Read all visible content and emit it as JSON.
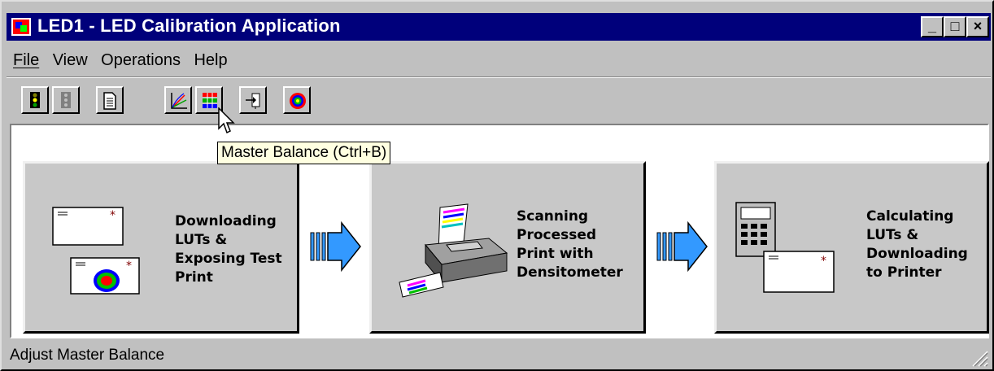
{
  "window": {
    "title": "LED1 - LED Calibration Application"
  },
  "titlebar_buttons": {
    "minimize": "_",
    "maximize": "□",
    "close": "×"
  },
  "menu": [
    "File",
    "View",
    "Operations",
    "Help"
  ],
  "toolbar": {
    "buttons": [
      {
        "name": "traffic-light-active-icon"
      },
      {
        "name": "traffic-light-inactive-icon"
      },
      {
        "name": "document-icon"
      },
      {
        "name": "curve-graph-icon"
      },
      {
        "name": "master-balance-icon"
      },
      {
        "name": "download-to-printer-icon"
      },
      {
        "name": "target-icon"
      }
    ],
    "tooltip": "Master Balance (Ctrl+B)"
  },
  "steps": [
    {
      "lines": [
        "Downloading",
        "LUTs &",
        "Exposing Test",
        "Print"
      ]
    },
    {
      "lines": [
        "Scanning",
        "Processed",
        "Print with",
        "Densitometer"
      ]
    },
    {
      "lines": [
        "Calculating",
        "LUTs &",
        "Downloading",
        "to Printer"
      ]
    }
  ],
  "status": {
    "text": "Adjust Master Balance"
  },
  "colors": {
    "title_bar": "#00007b",
    "tooltip_bg": "#ffffe1",
    "arrow_blue": "#3399ff"
  }
}
